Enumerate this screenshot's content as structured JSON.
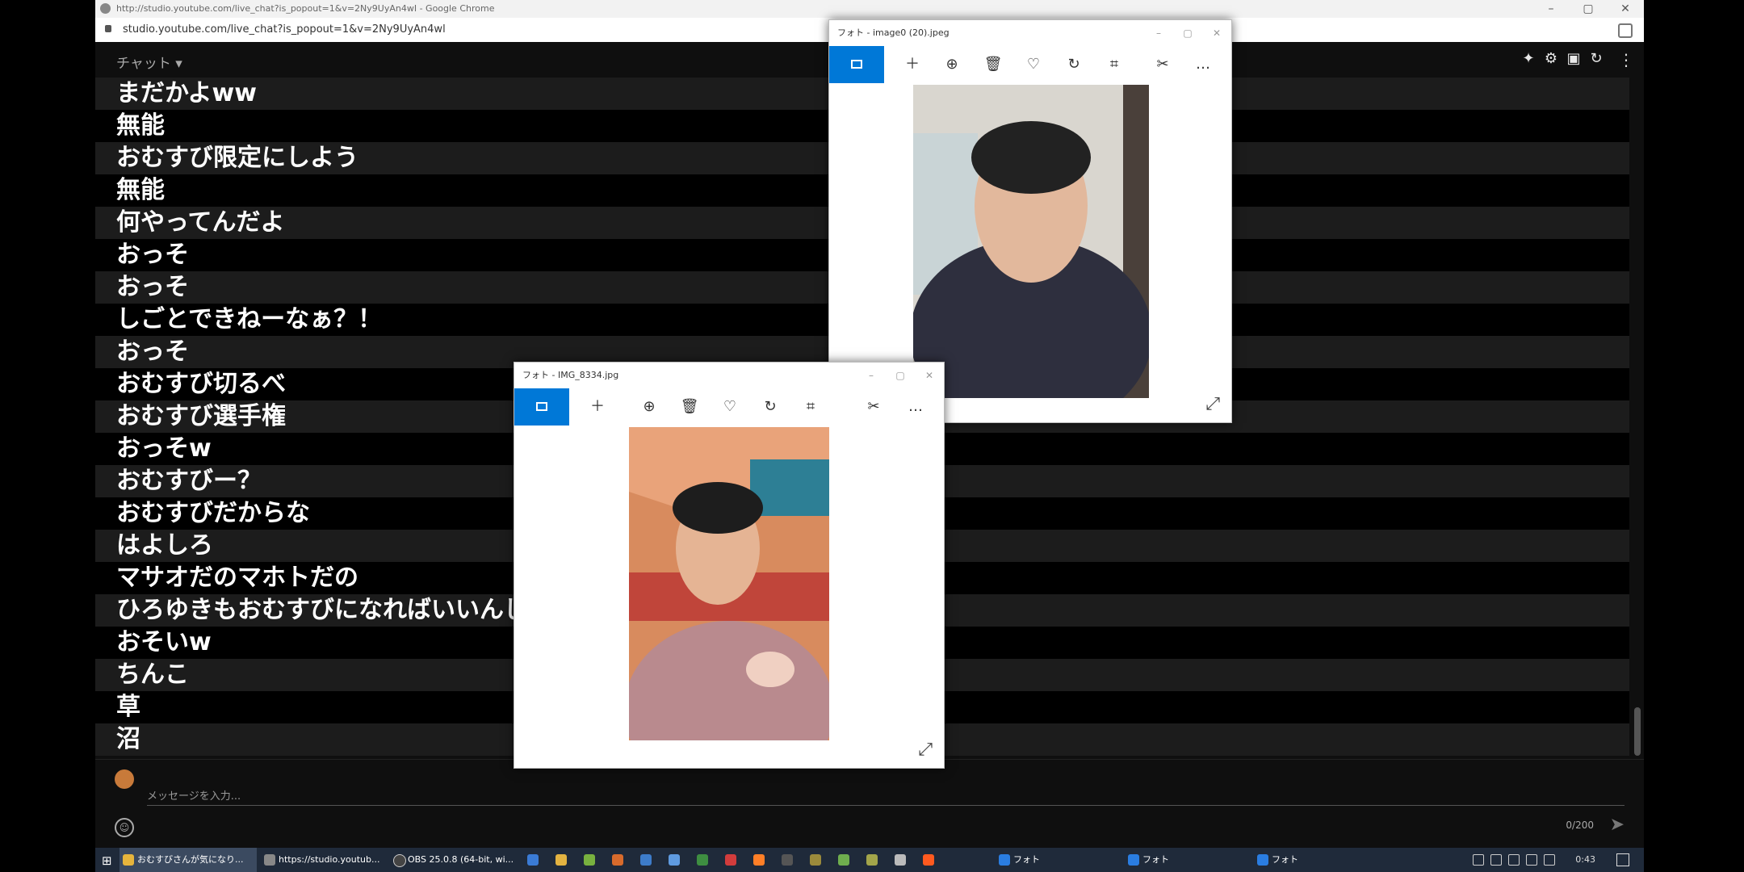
{
  "browser": {
    "window_title": "http://studio.youtube.com/live_chat?is_popout=1&v=2Ny9UyAn4wI - Google Chrome",
    "url": "studio.youtube.com/live_chat?is_popout=1&v=2Ny9UyAn4wl"
  },
  "chat": {
    "header_label": "チャット ▾",
    "messages": [
      "まだかよww",
      "無能",
      "おむすび限定にしよう",
      "無能",
      "何やってんだよ",
      "おっそ",
      "おっそ",
      "しごとできねーなぁ？！",
      "おっそ",
      "おむすび切るべ",
      "おむすび選手権",
      "おっそw",
      "おむすびー？",
      "おむすびだからな",
      "はよしろ",
      "マサオだのマホトだの",
      "ひろゆきもおむすびになればいいんじゃ",
      "おそいw",
      "ちんこ",
      "草",
      "沼"
    ],
    "input_placeholder": "メッセージを入力...",
    "char_count": "0/200"
  },
  "photo_windows": [
    {
      "title": "フォト - image0 (20).jpeg"
    },
    {
      "title": "フォト - IMG_8334.jpg"
    }
  ],
  "taskbar": {
    "items": [
      {
        "label": "おむすびさんが気になり...",
        "active": true
      },
      {
        "label": "https://studio.youtub...",
        "active": false
      },
      {
        "label": "OBS 25.0.8 (64-bit, wi...",
        "active": false
      },
      {
        "label": "フォト",
        "active": false
      },
      {
        "label": "フォト",
        "active": false
      },
      {
        "label": "フォト",
        "active": false
      }
    ],
    "time": "0:43"
  },
  "colors": {
    "accent": "#0078d7",
    "chat_bg": "#0f0f0f",
    "taskbar_bg": "#1f2a3a"
  }
}
